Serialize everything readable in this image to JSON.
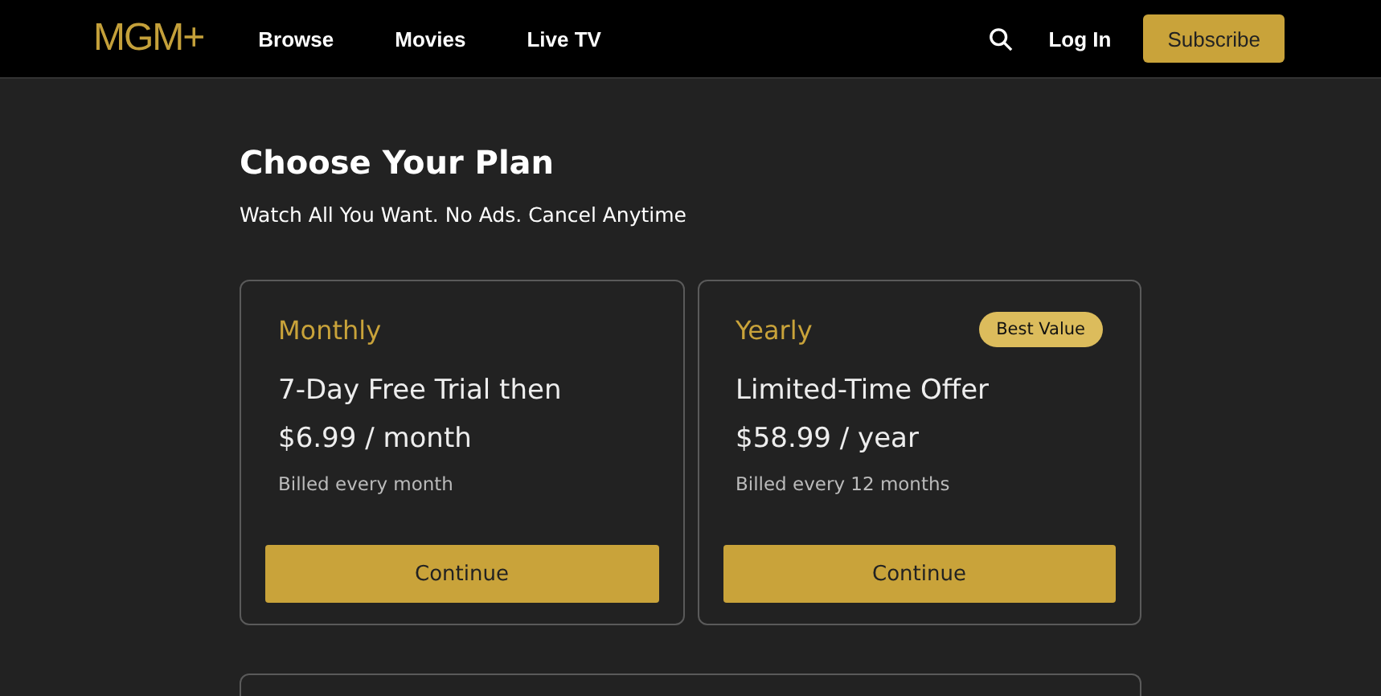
{
  "nav": {
    "logo": "MGM+",
    "links": [
      "Browse",
      "Movies",
      "Live TV"
    ],
    "login": "Log In",
    "subscribe": "Subscribe"
  },
  "heading": "Choose Your Plan",
  "subheading": "Watch All You Want. No Ads. Cancel Anytime",
  "plans": [
    {
      "name": "Monthly",
      "offer": "7-Day Free Trial then",
      "price": "$6.99 / month",
      "billing": "Billed every month",
      "button": "Continue"
    },
    {
      "name": "Yearly",
      "badge": "Best Value",
      "offer": "Limited-Time Offer",
      "price": "$58.99 / year",
      "billing": "Billed every 12 months",
      "button": "Continue"
    }
  ]
}
